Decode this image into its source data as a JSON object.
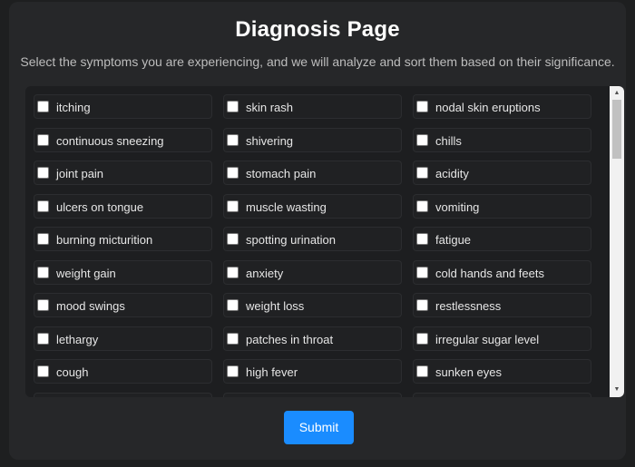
{
  "page": {
    "title": "Diagnosis Page",
    "subtitle": "Select the symptoms you are experiencing, and we will analyze and sort them based on their significance."
  },
  "symptoms": [
    "itching",
    "skin rash",
    "nodal skin eruptions",
    "continuous sneezing",
    "shivering",
    "chills",
    "joint pain",
    "stomach pain",
    "acidity",
    "ulcers on tongue",
    "muscle wasting",
    "vomiting",
    "burning micturition",
    "spotting urination",
    "fatigue",
    "weight gain",
    "anxiety",
    "cold hands and feets",
    "mood swings",
    "weight loss",
    "restlessness",
    "lethargy",
    "patches in throat",
    "irregular sugar level",
    "cough",
    "high fever",
    "sunken eyes"
  ],
  "submit_label": "Submit",
  "colors": {
    "background": "#1e1f20",
    "card": "#262729",
    "accent": "#1a8cff"
  }
}
